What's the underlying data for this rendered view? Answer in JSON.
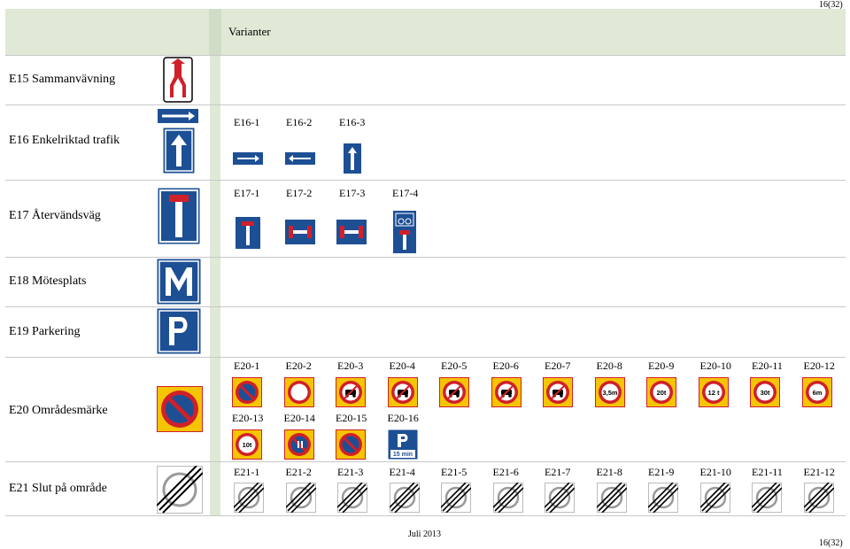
{
  "page": {
    "number_top": "16(32)",
    "number_bottom": "16(32)",
    "footer": "Juli 2013"
  },
  "header": {
    "title": "Varianter"
  },
  "colors": {
    "green_band": "#dfe9d6",
    "sign_blue": "#1d4f94",
    "sign_red": "#d0202a",
    "sign_yellow": "#f6c400"
  },
  "groups": [
    {
      "id": "E15",
      "label": "E15 Sammanvävning",
      "icon": "merge-sign-icon",
      "variants": []
    },
    {
      "id": "E16",
      "label": "E16 Enkelriktad trafik",
      "icon": "one-way-sign-icon",
      "variants": [
        {
          "code": "E16-1",
          "icon": "arrow-right-sign-icon"
        },
        {
          "code": "E16-2",
          "icon": "arrow-left-sign-icon"
        },
        {
          "code": "E16-3",
          "icon": "arrow-up-sign-icon"
        }
      ]
    },
    {
      "id": "E17",
      "label": "E17 Återvändsväg",
      "icon": "dead-end-sign-icon",
      "variants": [
        {
          "code": "E17-1",
          "icon": "dead-end-sign-icon"
        },
        {
          "code": "E17-2",
          "icon": "dead-end-both-sign-icon"
        },
        {
          "code": "E17-3",
          "icon": "dead-end-both-sign-icon"
        },
        {
          "code": "E17-4",
          "icon": "dead-end-bike-sign-icon"
        }
      ]
    },
    {
      "id": "E18",
      "label": "E18 Mötesplats",
      "icon": "passing-place-sign-icon",
      "variants": []
    },
    {
      "id": "E19",
      "label": "E19 Parkering",
      "icon": "parking-sign-icon",
      "variants": []
    },
    {
      "id": "E20",
      "label": "E20 Områdesmärke",
      "icon": "no-parking-zone-sign-icon",
      "row1_codes": [
        "E20-1",
        "E20-2",
        "E20-3",
        "E20-4",
        "E20-5",
        "E20-6",
        "E20-7",
        "E20-8",
        "E20-9",
        "E20-10",
        "E20-11",
        "E20-12"
      ],
      "row1_icons": [
        "no-parking-zone-icon",
        "no-stopping-zone-icon",
        "no-motorcycle-zone-icon",
        "no-car-zone-icon",
        "no-bus-zone-icon",
        "no-truck-zone-icon",
        "no-tractor-zone-icon",
        "height-limit-zone-icon",
        "weight-limit-20t-zone-icon",
        "weight-limit-12t-zone-icon",
        "weight-limit-30t-zone-icon",
        "length-limit-6m-zone-icon"
      ],
      "row1_texts": [
        "",
        "",
        "",
        "",
        "",
        "",
        "",
        "3,5m",
        "20t",
        "12 t",
        "30t",
        "6m"
      ],
      "row2_codes": [
        "E20-13",
        "E20-14",
        "E20-15",
        "E20-16"
      ],
      "row2_icons": [
        "axle-load-10t-zone-icon",
        "parking-odd-even-zone-icon",
        "no-parking-zone-icon",
        "parking-15-min-zone-icon"
      ],
      "row2_texts": [
        "10t",
        "",
        "",
        "15 min"
      ]
    },
    {
      "id": "E21",
      "label": "E21 Slut på område",
      "icon": "end-of-zone-sign-icon",
      "codes": [
        "E21-1",
        "E21-2",
        "E21-3",
        "E21-4",
        "E21-5",
        "E21-6",
        "E21-7",
        "E21-8",
        "E21-9",
        "E21-10",
        "E21-11",
        "E21-12"
      ]
    }
  ]
}
